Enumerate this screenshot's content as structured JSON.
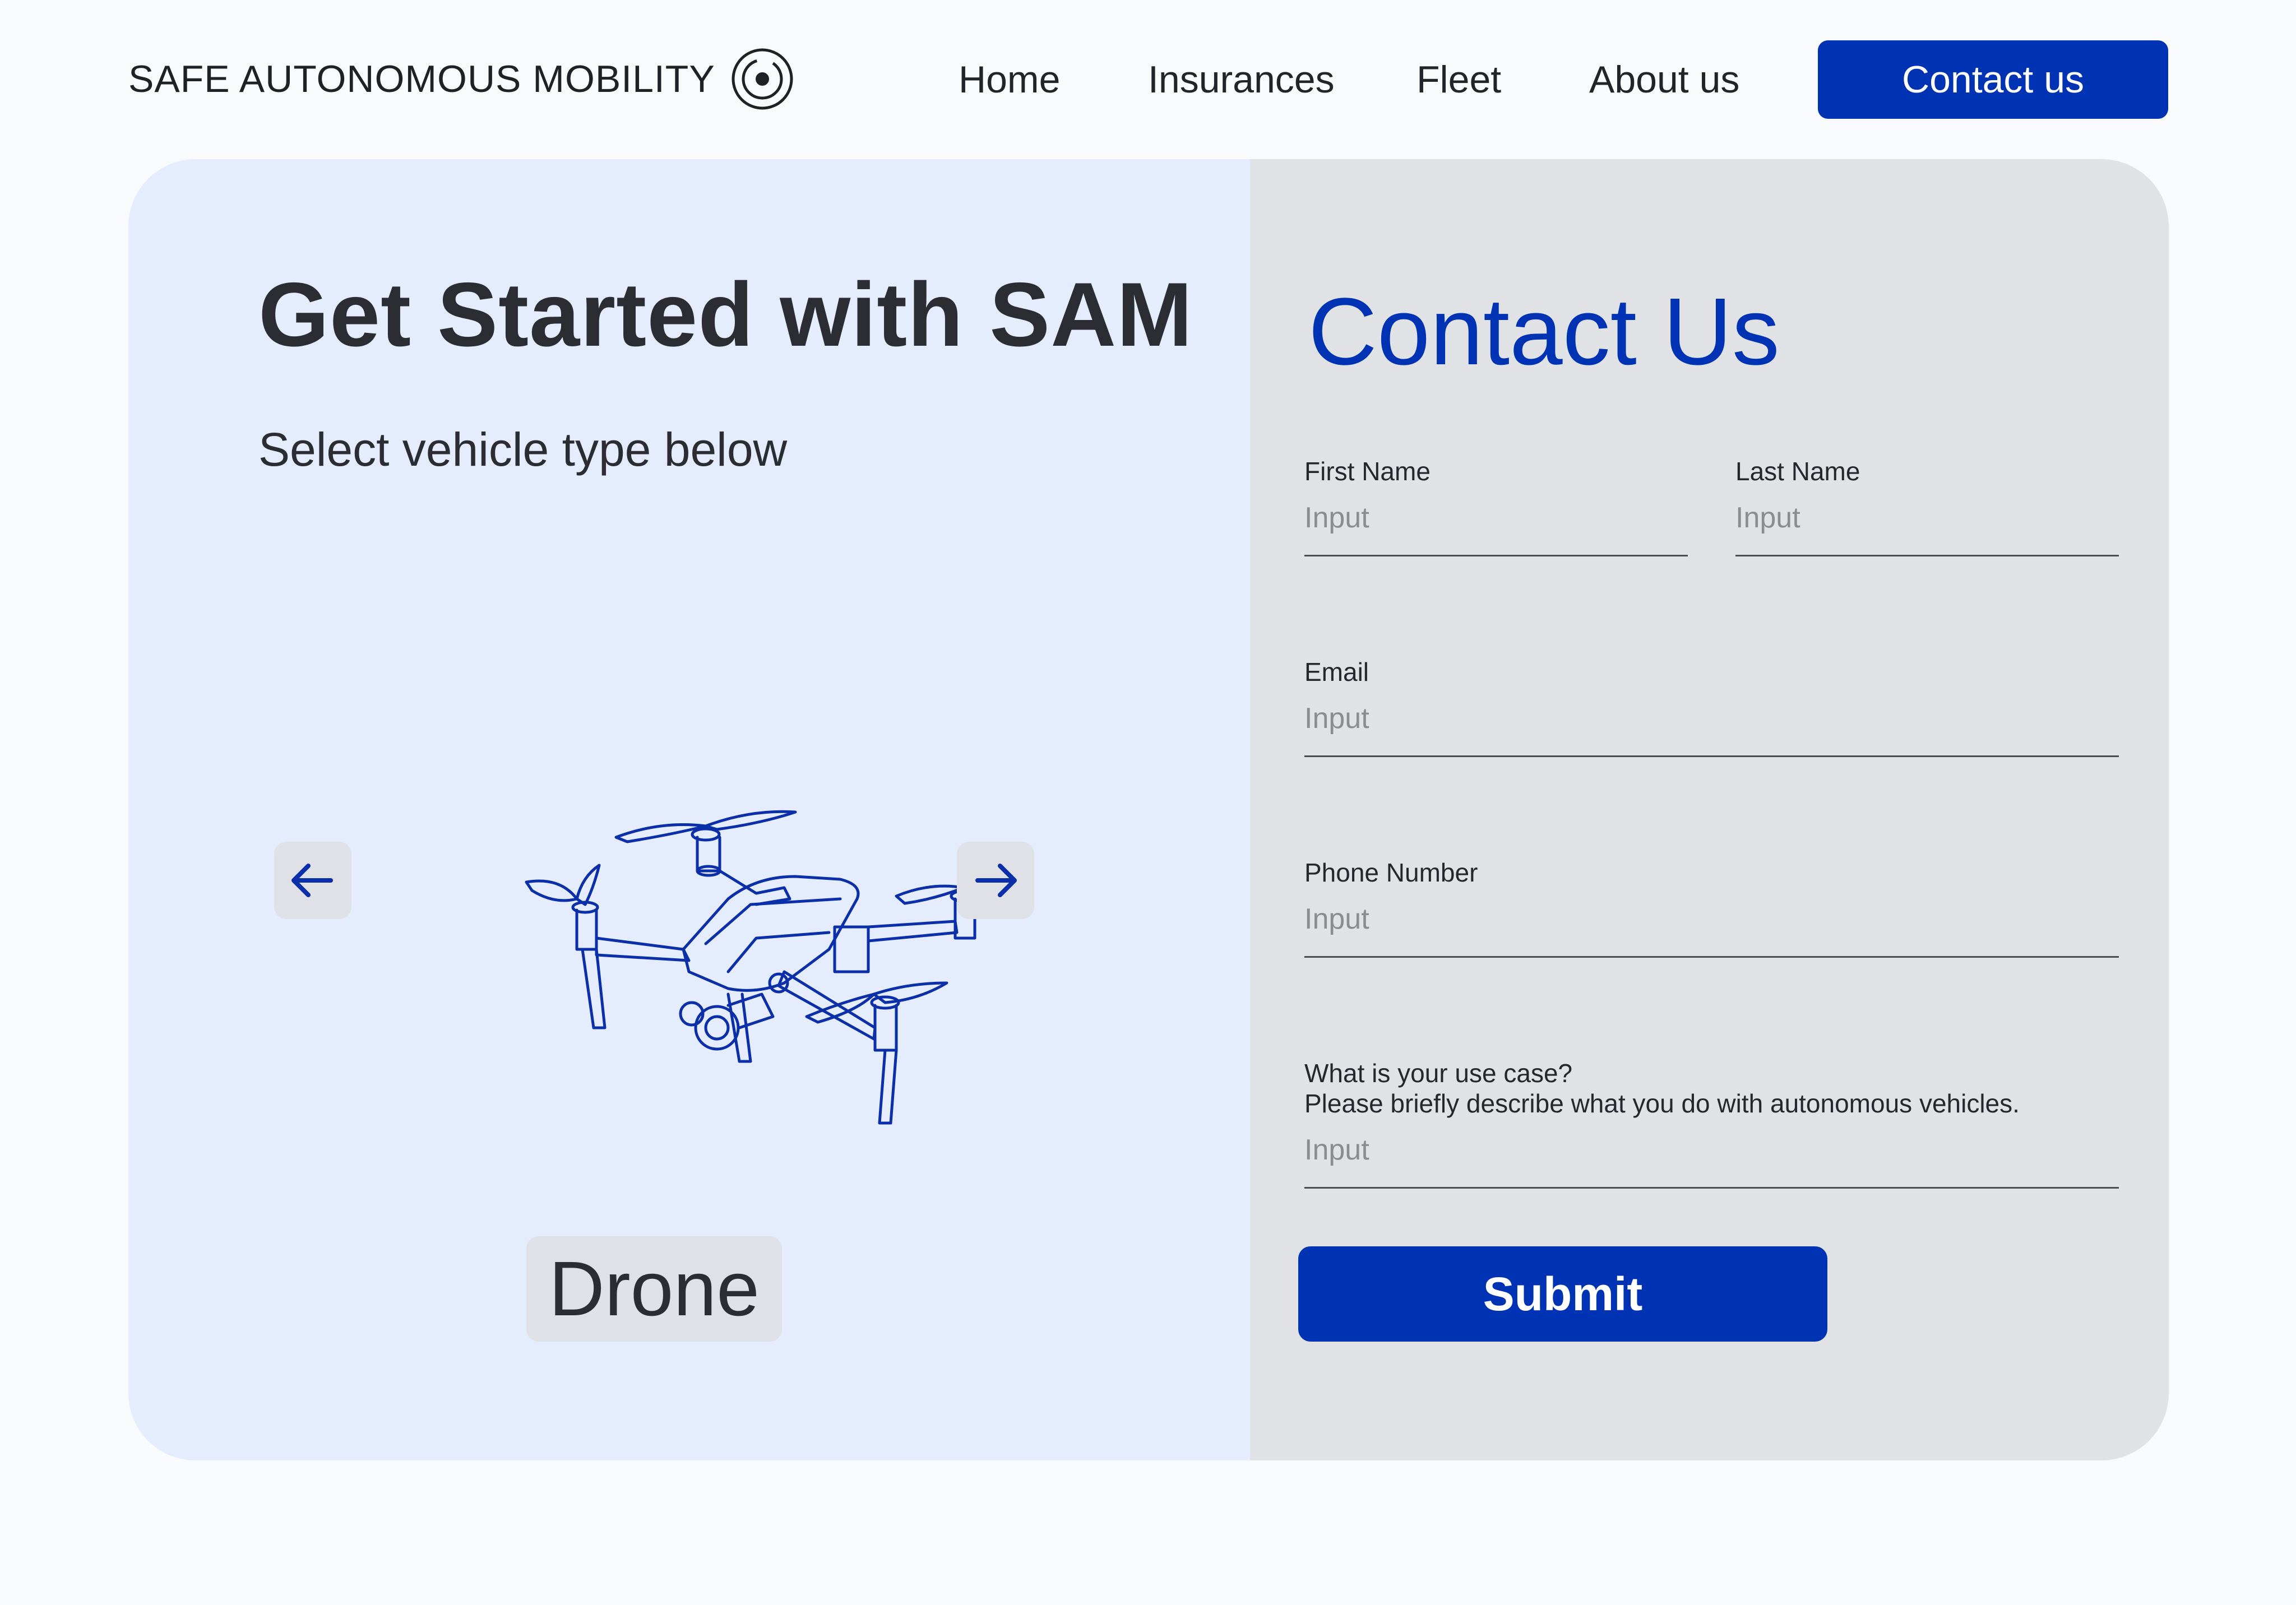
{
  "header": {
    "brand_name": "SAFE AUTONOMOUS MOBILITY",
    "brand_logo_icon": "concentric-circle-logo-icon",
    "nav_items": [
      {
        "label": "Home"
      },
      {
        "label": "Insurances"
      },
      {
        "label": "Fleet"
      },
      {
        "label": "About us"
      }
    ],
    "contact_button": "Contact us"
  },
  "hero": {
    "title": "Get Started with SAM",
    "subtitle": "Select vehicle type below",
    "vehicle_image_icon": "drone-icon",
    "prev_icon": "arrow-left-icon",
    "next_icon": "arrow-right-icon",
    "vehicle_label": "Drone"
  },
  "form": {
    "title": "Contact Us",
    "first_name": {
      "label": "First Name",
      "placeholder": "Input",
      "value": ""
    },
    "last_name": {
      "label": "Last Name",
      "placeholder": "Input",
      "value": ""
    },
    "email": {
      "label": "Email",
      "placeholder": "Input",
      "value": ""
    },
    "phone": {
      "label": "Phone Number",
      "placeholder": "Input",
      "value": ""
    },
    "use_case": {
      "label_line1": "What is your use case?",
      "label_line2": "Please briefly describe what you do with autonomous vehicles.",
      "placeholder": "Input",
      "value": ""
    },
    "submit_label": "Submit"
  },
  "colors": {
    "accent": "#0032b4",
    "page_background": "#f9fafb",
    "left_panel": "#e4ecfd",
    "right_panel": "#e0e2e6"
  }
}
